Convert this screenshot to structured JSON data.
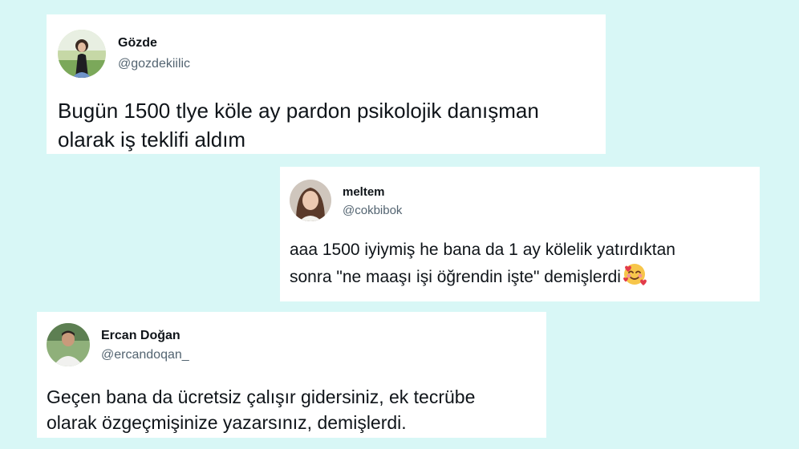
{
  "colors": {
    "background": "#d8f7f6",
    "card": "#ffffff",
    "text": "#0f1419",
    "handle": "#536471"
  },
  "tweets": [
    {
      "name": "Gözde",
      "handle": "@gozdekiilic",
      "lines": [
        "Bugün 1500 tlye köle ay pardon psikolojik danışman",
        "olarak iş teklifi aldım"
      ]
    },
    {
      "name": "meltem",
      "handle": "@cokbibok",
      "lines": [
        "aaa 1500 iyiymiş he bana da 1 ay kölelik yatırdıktan",
        "sonra \"ne maaşı işi öğrendin işte\" demişlerdi"
      ],
      "emoji": "smiling-face-with-hearts-icon"
    },
    {
      "name": "Ercan Doğan",
      "handle": "@ercandoqan_",
      "lines": [
        "Geçen bana da ücretsiz çalışır gidersiniz, ek tecrübe",
        "olarak özgeçmişinize yazarsınız, demişlerdi."
      ]
    }
  ]
}
